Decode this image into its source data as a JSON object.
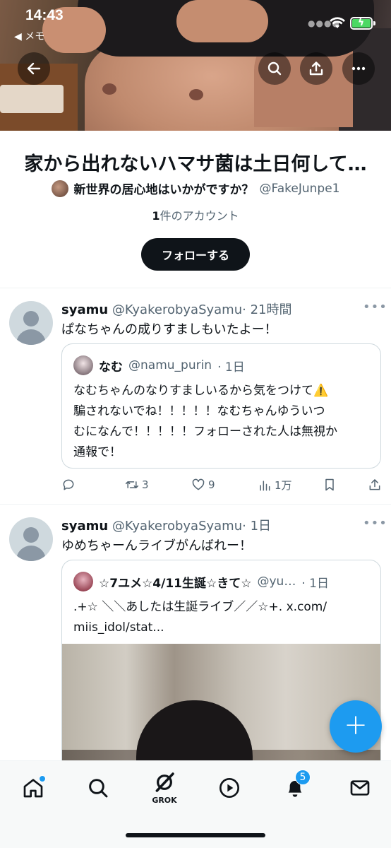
{
  "status_bar": {
    "time": "14:43",
    "back_app": "◀ メモ"
  },
  "list": {
    "title": "家から出れないハマサ菌は土日何して…",
    "owner_name": "新世界の居心地はいかがですか？",
    "owner_handle": "@FakeJunpe1",
    "account_count": "1",
    "account_suffix": "件のアカウント",
    "follow_label": "フォローする"
  },
  "posts": [
    {
      "name": "syamu",
      "handle": "@KyakerobyaSyamu",
      "time": "· 21時間",
      "text": "ぱなちゃんの成りすましもいたよー！",
      "quote": {
        "name": "なむ",
        "handle": "@namu_purin",
        "time": "· 1日",
        "lines": [
          "なむちゃんのなりすましいるから気をつけて⚠️",
          "騙されないでね！！！！！なむちゃんゆういつ",
          "むになんで！！！！！フォローされた人は無視か",
          "通報で！"
        ]
      },
      "actions": {
        "retweets": "3",
        "likes": "9",
        "views": "1万"
      }
    },
    {
      "name": "syamu",
      "handle": "@KyakerobyaSyamu",
      "time": "· 1日",
      "text": "ゆめちゃーんライブがんばれー！",
      "quote": {
        "name": "☆7ユメ☆4/11生誕☆きて☆",
        "handle": "@yu…",
        "time": "· 1日",
        "lines": [
          ".+☆ ＼＼あしたは生誕ライブ／／☆+. x.com/",
          "miis_idol/stat..."
        ]
      }
    }
  ],
  "more_glyph": "•••",
  "nav": {
    "grok_label": "GROK",
    "notifications_badge": "5"
  },
  "fab_glyph": "+",
  "colors": {
    "accent": "#1d9bf0",
    "text": "#0f1419",
    "secondary": "#536471"
  }
}
